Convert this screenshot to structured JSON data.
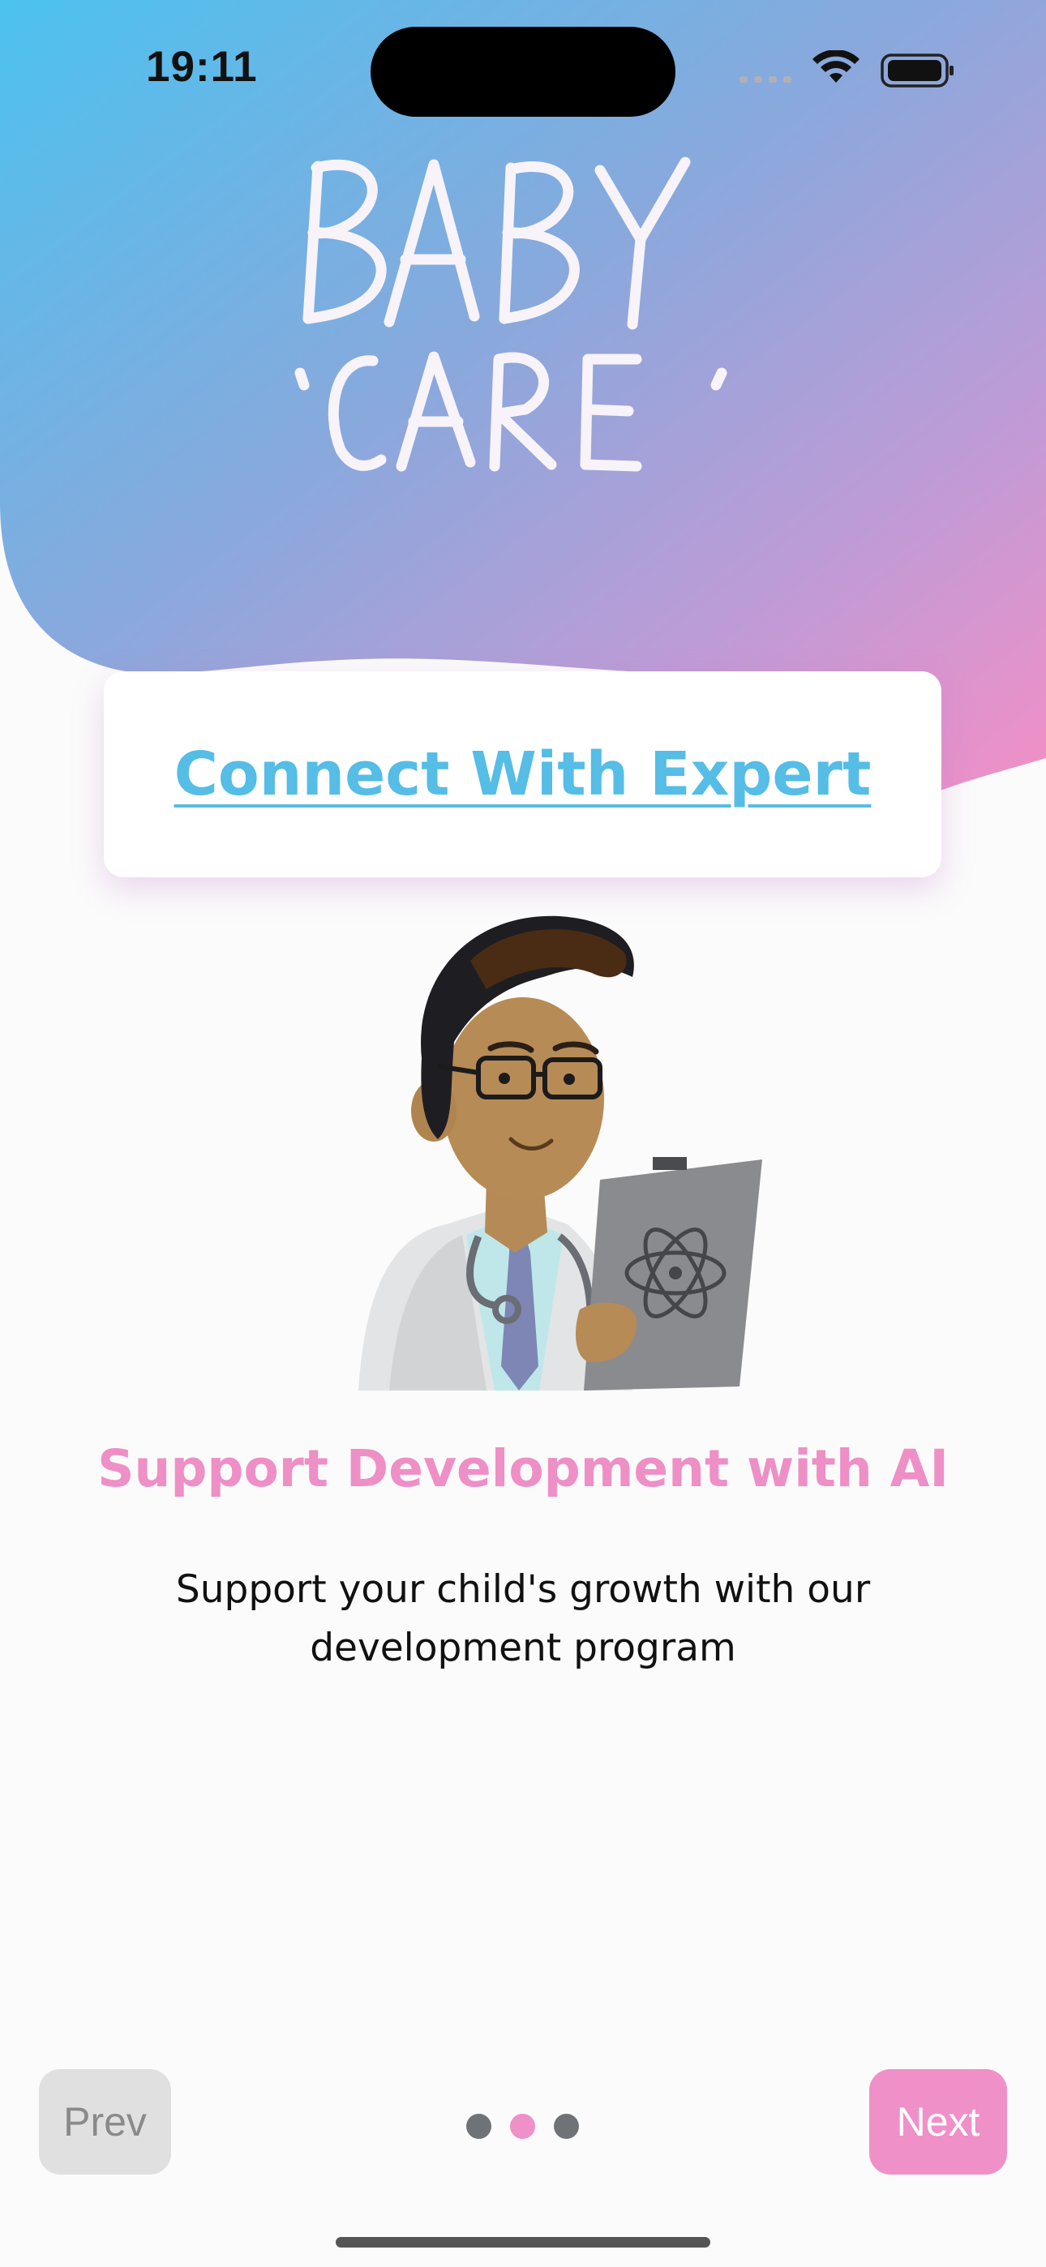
{
  "status_bar": {
    "time": "19:11"
  },
  "logo": {
    "line1": "BABY",
    "line2": "CARE"
  },
  "card": {
    "link_label": "Connect With Expert"
  },
  "onboarding": {
    "title": "Support Development with AI",
    "subtitle_line1": "Support your child's growth with our",
    "subtitle_line2": "development program"
  },
  "nav": {
    "prev_label": "Prev",
    "next_label": "Next",
    "page_count": 3,
    "active_page": 2
  },
  "colors": {
    "gradient_start": "#4fc3ee",
    "gradient_end": "#ee8fc8",
    "accent_pink": "#ef90c8",
    "link_blue": "#55bde6",
    "dot_inactive": "#6f7378",
    "dot_active": "#ef90c8"
  }
}
